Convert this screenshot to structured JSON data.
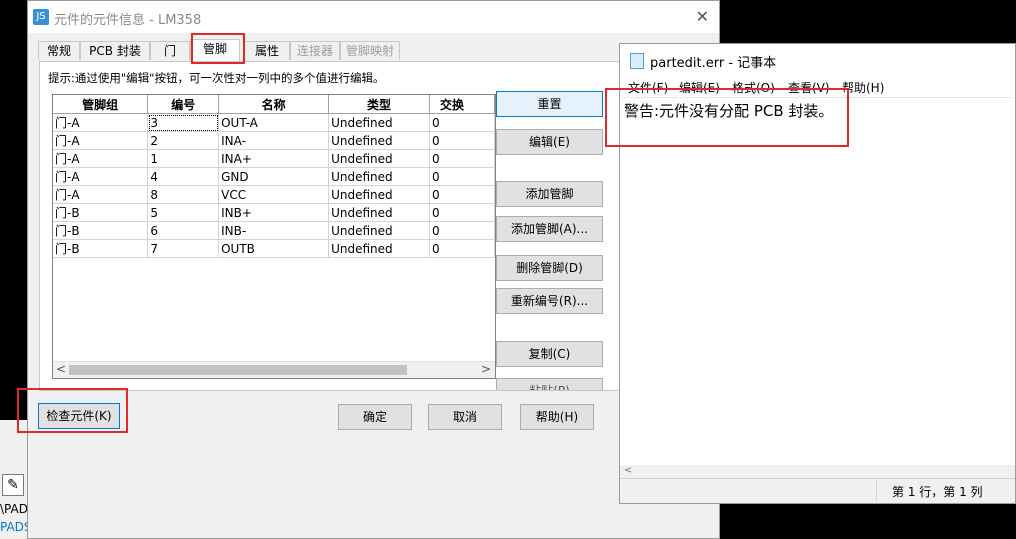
{
  "background_window": {
    "toolbar_icon": "pencil-icon",
    "line1": "\\PAD",
    "line2": "PADS"
  },
  "dialog": {
    "title": "元件的元件信息 - LM358",
    "close_glyph": "✕",
    "app_icon_text": "JS",
    "tabs": [
      {
        "label": "常规"
      },
      {
        "label": "PCB 封装"
      },
      {
        "label": "门"
      },
      {
        "label": "管脚"
      },
      {
        "label": "属性"
      },
      {
        "label": "连接器"
      },
      {
        "label": "管脚映射"
      }
    ],
    "hint": "提示:通过使用\"编辑\"按钮，可一次性对一列中的多个值进行编辑。",
    "columns": [
      "管脚组",
      "编号",
      "名称",
      "类型",
      "交换"
    ],
    "rows": [
      [
        "门-A",
        "3",
        "OUT-A",
        "Undefined",
        "0"
      ],
      [
        "门-A",
        "2",
        "INA-",
        "Undefined",
        "0"
      ],
      [
        "门-A",
        "1",
        "INA+",
        "Undefined",
        "0"
      ],
      [
        "门-A",
        "4",
        "GND",
        "Undefined",
        "0"
      ],
      [
        "门-A",
        "8",
        "VCC",
        "Undefined",
        "0"
      ],
      [
        "门-B",
        "5",
        "INB+",
        "Undefined",
        "0"
      ],
      [
        "门-B",
        "6",
        "INB-",
        "Undefined",
        "0"
      ],
      [
        "门-B",
        "7",
        "OUTB",
        "Undefined",
        "0"
      ]
    ],
    "side_buttons": {
      "reset": "重置",
      "edit": "编辑(E)",
      "add_pin": "添加管脚",
      "add_pins": "添加管脚(A)...",
      "delete_pin": "删除管脚(D)",
      "renumber": "重新编号(R)...",
      "copy": "复制(C)",
      "paste_partial": "粘贴(P)"
    },
    "footer": {
      "check": "检查元件(K)",
      "ok": "确定",
      "cancel": "取消",
      "help": "帮助(H)"
    }
  },
  "notepad": {
    "title": "partedit.err - 记事本",
    "menu": [
      "文件(F)",
      "编辑(E)",
      "格式(O)",
      "查看(V)",
      "帮助(H)"
    ],
    "content": "警告:元件没有分配 PCB 封装。",
    "status": "第 1 行，第 1 列"
  },
  "colors": {
    "highlight": "#e3282a",
    "focus": "#0078d7"
  }
}
